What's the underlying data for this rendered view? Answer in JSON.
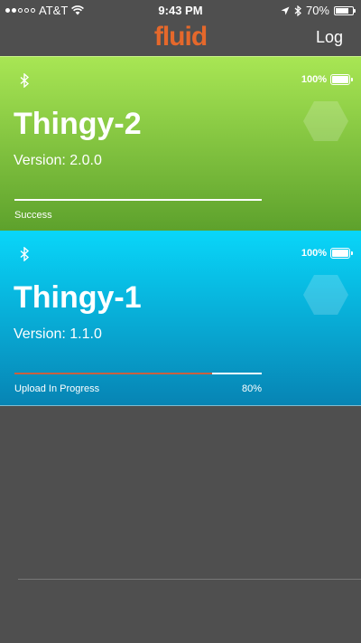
{
  "status_bar": {
    "carrier": "AT&T",
    "time": "9:43 PM",
    "battery_percent": "70%"
  },
  "nav": {
    "logo_text": "fluid",
    "log_label": "Log"
  },
  "colors": {
    "logo": "#e5682b",
    "green_top": "#a8e654",
    "green_bottom": "#5da12c",
    "blue_top": "#09d6f9",
    "blue_bottom": "#0784b4",
    "progress_fill": "#c86140",
    "background": "#4f4f4f"
  },
  "devices": [
    {
      "name": "Thingy-2",
      "version": "Version: 2.0.0",
      "battery": "100%",
      "status": "Success",
      "progress_percent": null,
      "progress_fraction": 0
    },
    {
      "name": "Thingy-1",
      "version": "Version: 1.1.0",
      "battery": "100%",
      "status": "Upload In Progress",
      "progress_percent": "80%",
      "progress_fraction": 0.8
    }
  ]
}
